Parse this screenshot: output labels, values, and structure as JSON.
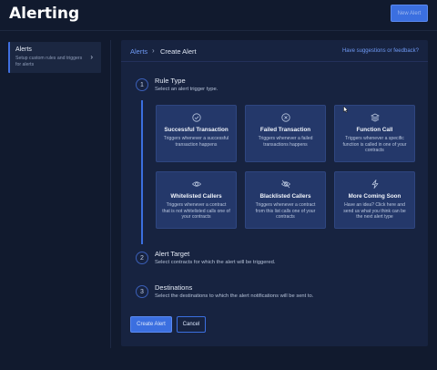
{
  "page": {
    "title": "Alerting",
    "new_alert_label": "New Alert"
  },
  "sidebar": {
    "items": [
      {
        "label": "Alerts",
        "description": "Setup custom rules and triggers for alerts"
      }
    ]
  },
  "breadcrumb": {
    "root": "Alerts",
    "separator": "›",
    "current": "Create Alert"
  },
  "feedback_link": "Have suggestions or feedback?",
  "steps": [
    {
      "number": "1",
      "title": "Rule Type",
      "subtitle": "Select an alert trigger type."
    },
    {
      "number": "2",
      "title": "Alert Target",
      "subtitle": "Select contracts for which the alert will be triggered."
    },
    {
      "number": "3",
      "title": "Destinations",
      "subtitle": "Select the destinations to which the alert notifications will be sent to."
    }
  ],
  "rule_types": [
    {
      "icon": "check-circle-icon",
      "title": "Successful Transaction",
      "description": "Triggers whenever a successful transaction happens"
    },
    {
      "icon": "x-circle-icon",
      "title": "Failed Transaction",
      "description": "Triggers whenever a failed transactions happens"
    },
    {
      "icon": "layers-icon",
      "title": "Function Call",
      "description": "Triggers whenever a specific function is called in one of your contracts"
    },
    {
      "icon": "eye-icon",
      "title": "Whitelisted Callers",
      "description": "Triggers whenever a contract that is not whitelisted calls one of your contracts"
    },
    {
      "icon": "eye-off-icon",
      "title": "Blacklisted Callers",
      "description": "Triggers whenever a contract from this list calls one of your contracts"
    },
    {
      "icon": "lightning-icon",
      "title": "More Coming Soon",
      "description": "Have an idea? Click here and send us what you think can be the next alert type"
    }
  ],
  "actions": {
    "create_label": "Create Alert",
    "cancel_label": "Cancel"
  },
  "colors": {
    "accent": "#3b6fe0",
    "link": "#6f9af5",
    "background": "#111a2e",
    "panel": "#172340",
    "card": "#24386a"
  }
}
